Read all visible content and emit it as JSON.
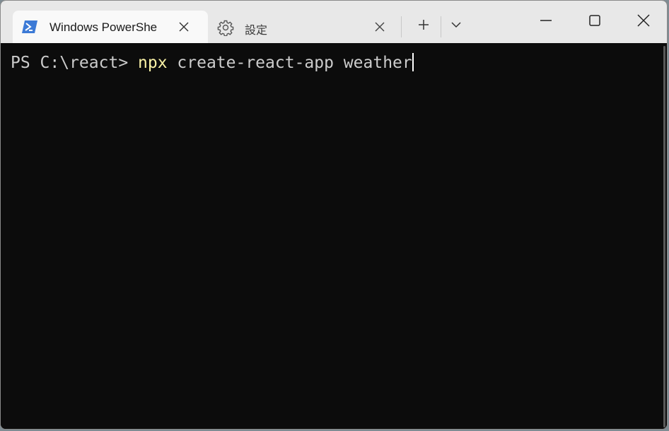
{
  "tabs": [
    {
      "label": "Windows PowerShe",
      "icon": "powershell-icon",
      "active": true
    },
    {
      "label": "設定",
      "icon": "gear-icon",
      "active": false
    }
  ],
  "toolbar": {
    "new_tab_icon": "plus-icon",
    "dropdown_icon": "chevron-down-icon"
  },
  "window_controls": {
    "minimize_icon": "minimize-icon",
    "maximize_icon": "maximize-icon",
    "close_icon": "close-icon"
  },
  "console": {
    "prompt": "PS C:\\react> ",
    "command": "npx",
    "arguments": " create-react-app weather"
  },
  "colors": {
    "background": "#0c0c0c",
    "text": "#cccccc",
    "command": "#f9f1a5",
    "powershell_blue": "#3c7ad6"
  }
}
